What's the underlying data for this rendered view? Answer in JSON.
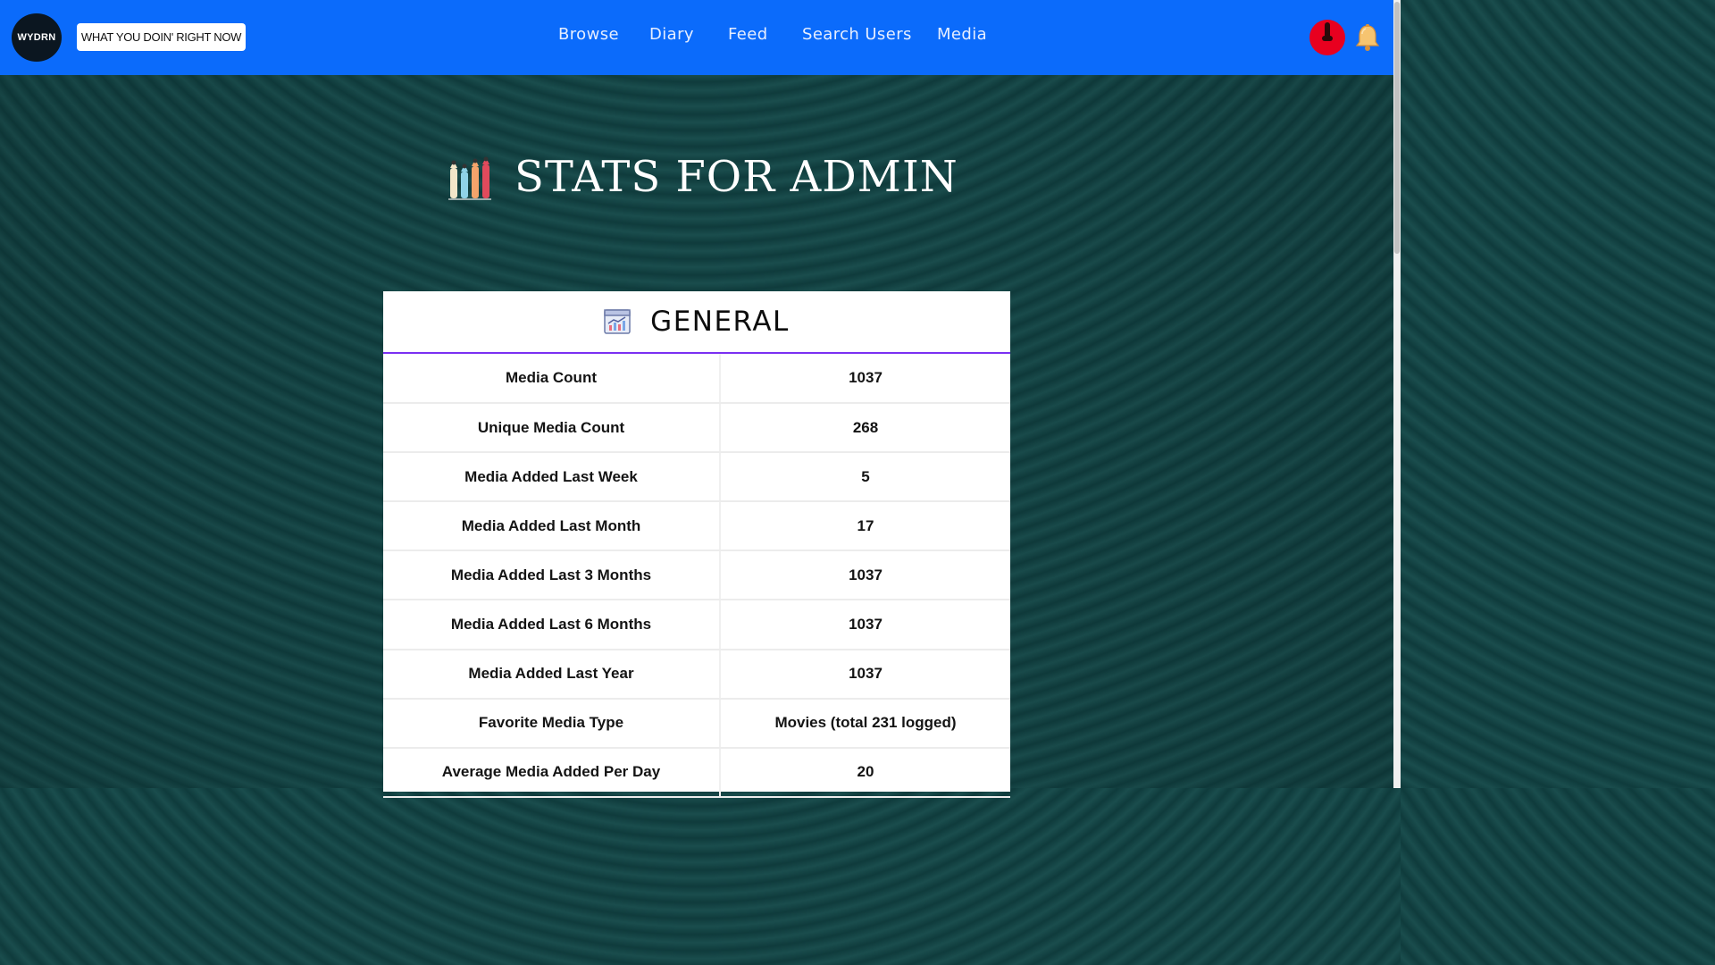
{
  "navbar": {
    "logo_text": "WYDRN",
    "tagline": "WHAT YOU DOIN' RIGHT NOW",
    "links": [
      "Browse",
      "Diary",
      "Feed",
      "Search Users",
      "Media"
    ],
    "brand_color": "#0b6bfb"
  },
  "page": {
    "title": "STATS FOR ADMIN",
    "title_icon": "bar-chart-pencils-icon"
  },
  "general": {
    "heading": "GENERAL",
    "heading_icon": "line-chart-window-icon",
    "rows": [
      {
        "label": "Media Count",
        "value": "1037"
      },
      {
        "label": "Unique Media Count",
        "value": "268"
      },
      {
        "label": "Media Added Last Week",
        "value": "5"
      },
      {
        "label": "Media Added Last Month",
        "value": "17"
      },
      {
        "label": "Media Added Last 3 Months",
        "value": "1037"
      },
      {
        "label": "Media Added Last 6 Months",
        "value": "1037"
      },
      {
        "label": "Media Added Last Year",
        "value": "1037"
      },
      {
        "label": "Favorite Media Type",
        "value": "Movies (total 231 logged)"
      },
      {
        "label": "Average Media Added Per Day",
        "value": "20"
      }
    ]
  }
}
